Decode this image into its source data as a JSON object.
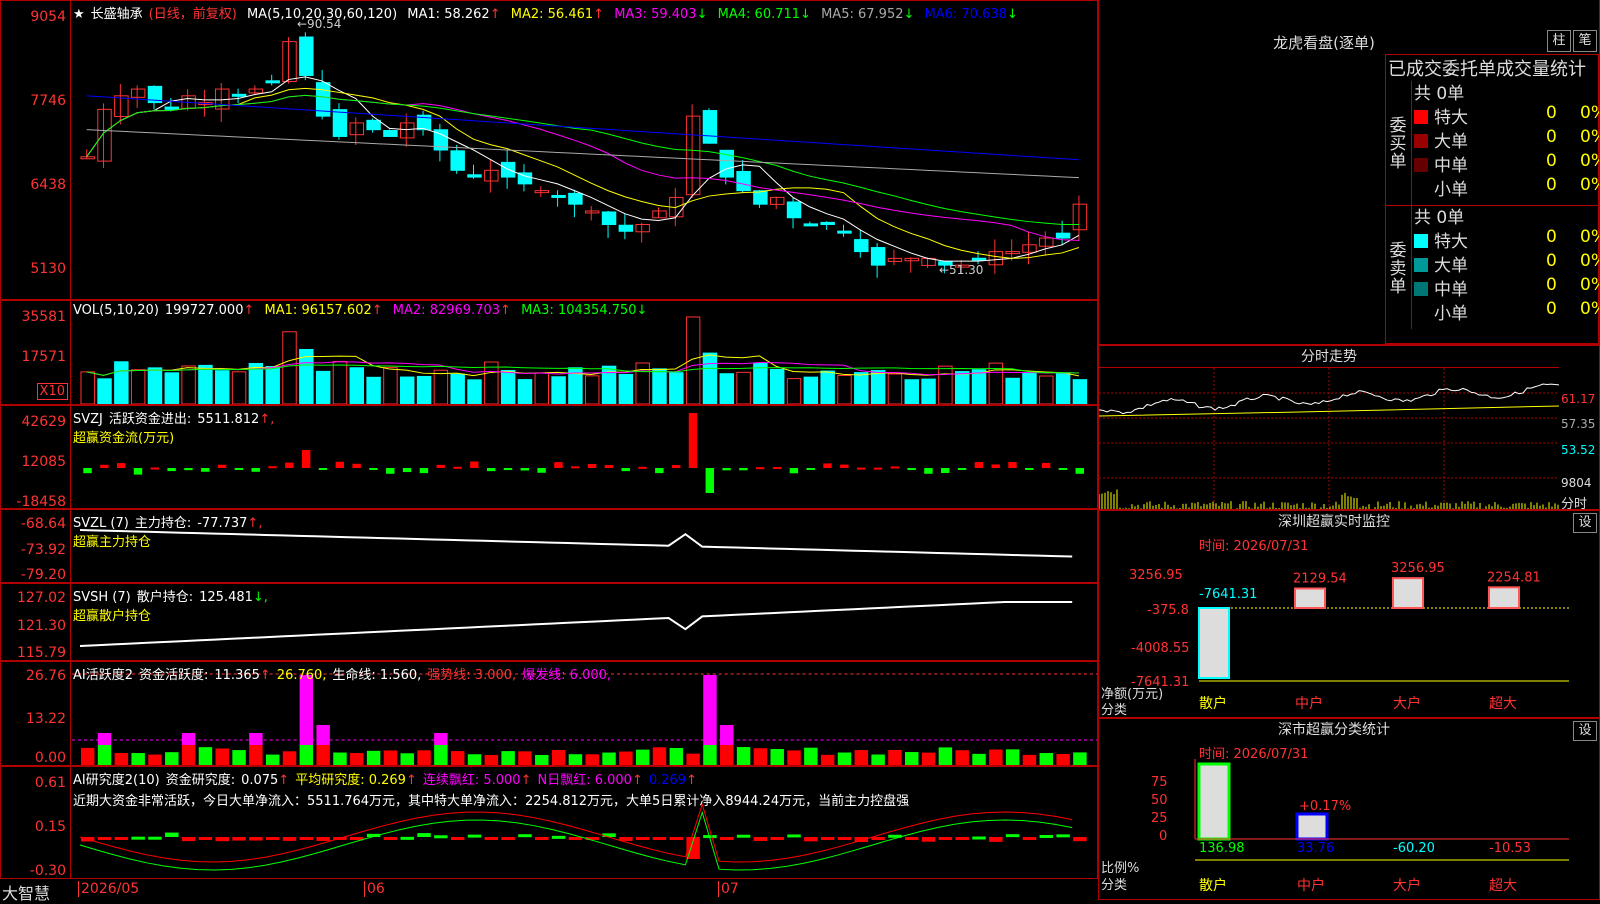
{
  "app": {
    "name": "大智慧"
  },
  "stock": {
    "star": "★",
    "name": "长盛轴承",
    "period": "(日线，前复权)"
  },
  "colors": {
    "up": "#ff3333",
    "down": "#00ffff",
    "ma1": "#ffffff",
    "ma2": "#ffff00",
    "ma3": "#ff00ff",
    "ma4": "#00ff00",
    "ma5": "#aaaaaa",
    "ma6": "#0000ff",
    "grid": "#b00000"
  },
  "price_panel": {
    "ma_label": "MA(5,10,20,30,60,120)",
    "ma": [
      {
        "k": "MA1:",
        "v": "58.262",
        "arrow": "↑"
      },
      {
        "k": "MA2:",
        "v": "56.461",
        "arrow": "↑"
      },
      {
        "k": "MA3:",
        "v": "59.403",
        "arrow": "↓"
      },
      {
        "k": "MA4:",
        "v": "60.711",
        "arrow": "↓"
      },
      {
        "k": "MA5:",
        "v": "67.952",
        "arrow": "↓"
      },
      {
        "k": "MA6:",
        "v": "70.638",
        "arrow": "↓"
      }
    ],
    "ticks": [
      "9054",
      "7746",
      "6438",
      "5130"
    ],
    "high_label": "←90.54",
    "low_label": "←51.30"
  },
  "vol_panel": {
    "label": "VOL(5,10,20)",
    "value": "199727.000",
    "arrow": "↑",
    "ma": [
      {
        "k": "MA1:",
        "v": "96157.602",
        "arrow": "↑"
      },
      {
        "k": "MA2:",
        "v": "82969.703",
        "arrow": "↑"
      },
      {
        "k": "MA3:",
        "v": "104354.750",
        "arrow": "↓"
      }
    ],
    "ticks": [
      "35581",
      "17571"
    ],
    "unit": "X10"
  },
  "svzj": {
    "label": "SVZJ",
    "name": "活跃资金进出:",
    "value": "5511.812",
    "arrow": "↑,",
    "sub": "超赢资金流(万元)",
    "ticks": [
      "42629",
      "12085",
      "-18458"
    ]
  },
  "svzl": {
    "label": "SVZL (7)",
    "name": "主力持仓:",
    "value": "-77.737",
    "arrow": "↑,",
    "sub": "超赢主力持仓",
    "ticks": [
      "-68.64",
      "-73.92",
      "-79.20"
    ]
  },
  "svsh": {
    "label": "SVSH (7)",
    "name": "散户持仓:",
    "value": "125.481",
    "arrow": "↓,",
    "sub": "超赢散户持仓",
    "ticks": [
      "127.02",
      "121.30",
      "115.79"
    ]
  },
  "ai_act": {
    "label": "AI活跃度2",
    "name": "资金活跃度:",
    "value": "11.365",
    "arrow": "↑",
    "v2": "26.760,",
    "life": "生命线: 1.560,",
    "strong": "强势线: 3.000,",
    "burst": "爆发线: 6.000,",
    "ticks": [
      "26.76",
      "13.22",
      "0.00"
    ]
  },
  "ai_res": {
    "label": "AI研究度2(10)",
    "name": "资金研究度:",
    "value": "0.075",
    "arrow": "↑",
    "avg": "平均研究度: 0.269",
    "avg_arrow": "↑",
    "cont": "连续飘红: 5.000",
    "cont_arrow": "↑",
    "nday": "N日飘红: 6.000",
    "nday_arrow": "↑",
    "last": "0.269",
    "last_arrow": "↑",
    "text": "近期大资金非常活跃，今日大单净流入：5511.764万元，其中特大单净流入：2254.812万元，大单5日累计净入8944.24万元，当前主力控盘强",
    "ticks": [
      "0.61",
      "0.15",
      "-0.30"
    ]
  },
  "xaxis": {
    "labels": [
      "2026/05",
      "06",
      "07"
    ]
  },
  "lhb": {
    "title": "龙虎看盘(逐单)",
    "btn1": "柱",
    "btn2": "笔",
    "subtitle": "已成交委托单成交量统计",
    "buy_label": "委买单",
    "sell_label": "委卖单",
    "buy_total": "共 0单",
    "sell_total": "共 0单",
    "buy": [
      {
        "name": "特大",
        "color": "#ff0000",
        "n": "0",
        "p": "0%"
      },
      {
        "name": "大单",
        "color": "#990000",
        "n": "0",
        "p": "0%"
      },
      {
        "name": "中单",
        "color": "#660000",
        "n": "0",
        "p": "0%"
      },
      {
        "name": "小单",
        "color": "#000000",
        "n": "0",
        "p": "0%"
      }
    ],
    "sell": [
      {
        "name": "特大",
        "color": "#00ffff",
        "n": "0",
        "p": "0%"
      },
      {
        "name": "大单",
        "color": "#009999",
        "n": "0",
        "p": "0%"
      },
      {
        "name": "中单",
        "color": "#007777",
        "n": "0",
        "p": "0%"
      },
      {
        "name": "小单",
        "color": "#000000",
        "n": "0",
        "p": "0%"
      }
    ]
  },
  "fenshi": {
    "title": "分时走势",
    "ticks": [
      "61.17",
      "57.35",
      "53.52",
      "9804"
    ],
    "unit": "分时"
  },
  "sz_monitor": {
    "title": "深圳超赢实时监控",
    "btn": "设",
    "time": "时间: 2026/07/31",
    "ticks": [
      "3256.95",
      "-375.8",
      "-4008.55",
      "-7641.31"
    ],
    "unit1": "净额(万元)",
    "unit2": "分类",
    "bars": [
      {
        "label": "-7641.31",
        "value": -7641.31
      },
      {
        "label": "2129.54",
        "value": 2129.54
      },
      {
        "label": "3256.95",
        "value": 3256.95
      },
      {
        "label": "2254.81",
        "value": 2254.81
      }
    ],
    "cats": [
      "散户",
      "中户",
      "大户",
      "超大"
    ]
  },
  "sz_class": {
    "title": "深市超赢分类统计",
    "btn": "设",
    "time": "时间: 2026/07/31",
    "ticks": [
      "75",
      "50",
      "25",
      "0"
    ],
    "unit1": "比例%",
    "unit2": "分类",
    "bar_label": "+0.17%",
    "vals": [
      "136.98",
      "33.76",
      "-60.20",
      "-10.53"
    ],
    "cats": [
      "散户",
      "中户",
      "大户",
      "超大"
    ]
  }
}
